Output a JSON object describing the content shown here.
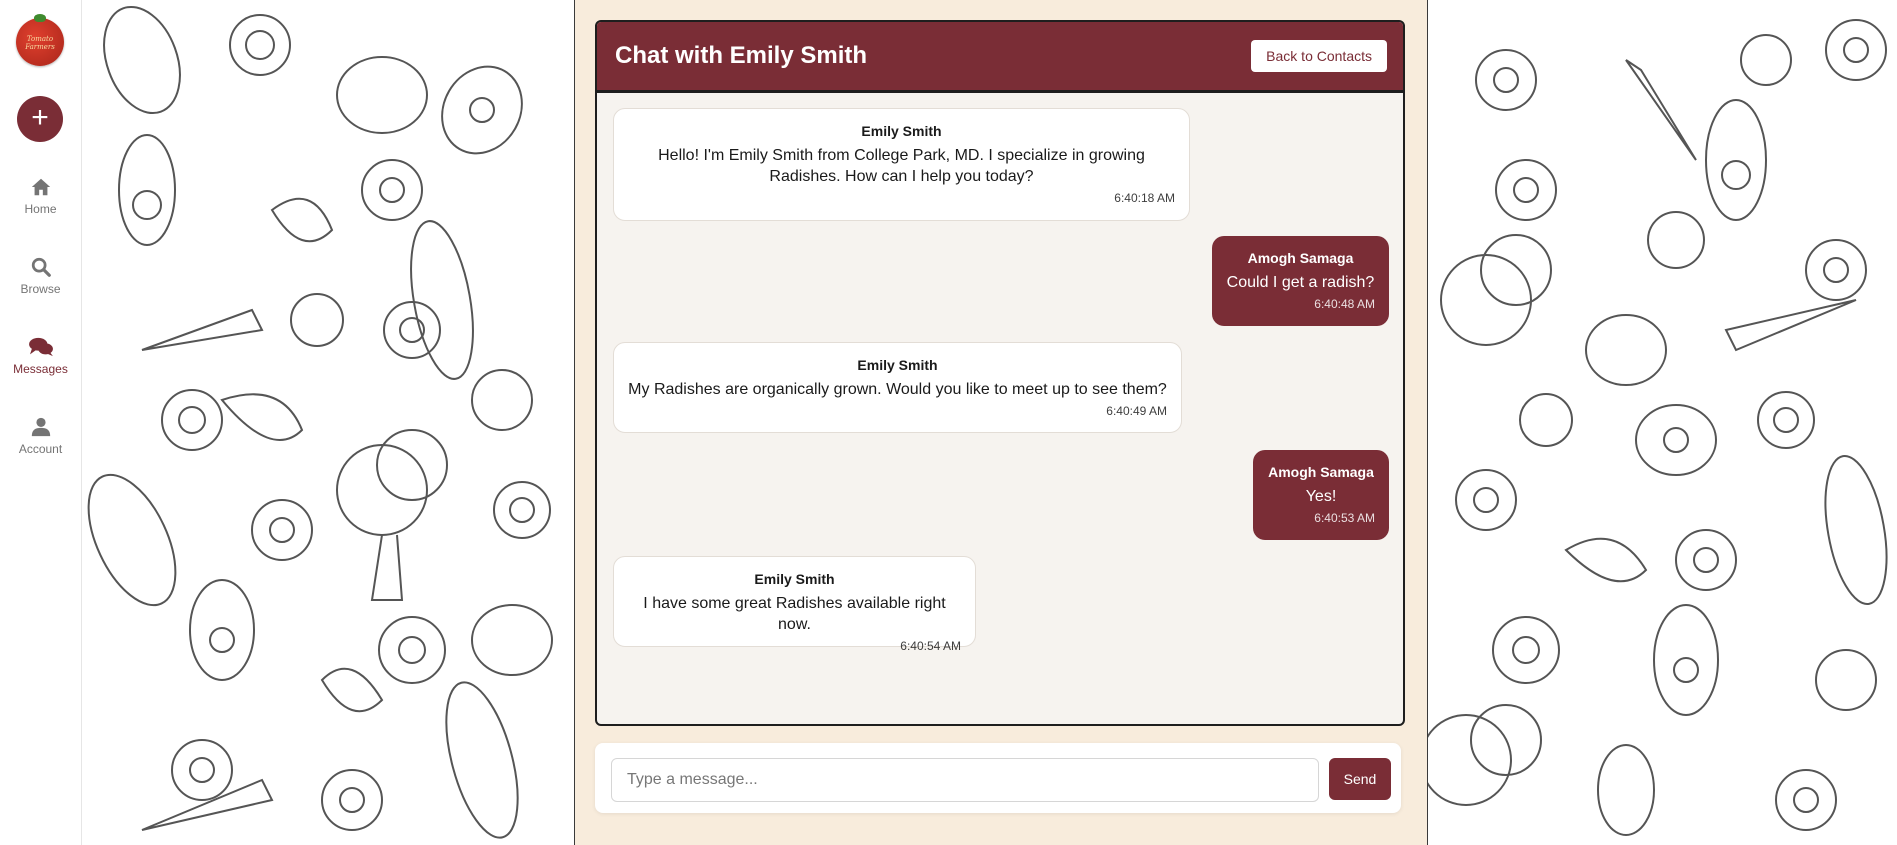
{
  "sidebar": {
    "logo_text": "Tomato Farmers",
    "add_label": "+",
    "items": [
      {
        "label": "Home",
        "icon": "home-icon"
      },
      {
        "label": "Browse",
        "icon": "search-icon"
      },
      {
        "label": "Messages",
        "icon": "chat-icon",
        "active": true
      },
      {
        "label": "Account",
        "icon": "user-icon"
      }
    ]
  },
  "chat": {
    "title": "Chat with Emily Smith",
    "back_label": "Back to Contacts",
    "messages": [
      {
        "direction": "in",
        "sender": "Emily Smith",
        "text": "Hello! I'm Emily Smith from College Park, MD. I specialize in growing Radishes. How can I help you today?",
        "time": "6:40:18 AM"
      },
      {
        "direction": "out",
        "sender": "Amogh Samaga",
        "text": "Could I get a radish?",
        "time": "6:40:48 AM"
      },
      {
        "direction": "in",
        "sender": "Emily Smith",
        "text": "My Radishes are organically grown. Would you like to meet up to see them?",
        "time": "6:40:49 AM"
      },
      {
        "direction": "out",
        "sender": "Amogh Samaga",
        "text": "Yes!",
        "time": "6:40:53 AM"
      },
      {
        "direction": "in",
        "sender": "Emily Smith",
        "text": "I have some great Radishes available right now.",
        "time": "6:40:54 AM"
      }
    ]
  },
  "composer": {
    "placeholder": "Type a message...",
    "send_label": "Send"
  },
  "colors": {
    "accent": "#7a2d36",
    "page_bg": "#f8ecdc"
  }
}
